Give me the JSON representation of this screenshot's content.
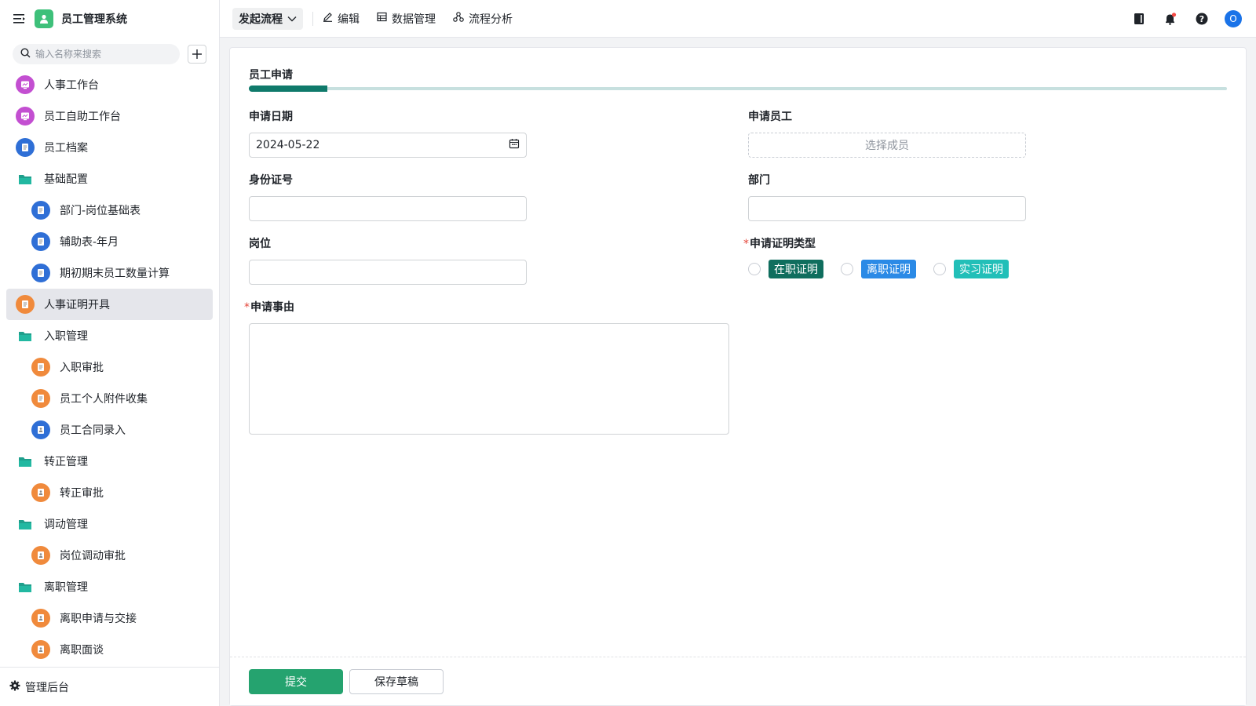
{
  "app": {
    "title": "员工管理系统"
  },
  "sidebar": {
    "search_placeholder": "输入名称来搜索",
    "items": [
      {
        "label": "人事工作台",
        "type": "app",
        "color": "#c34fd1",
        "icon": "dashboard-icon"
      },
      {
        "label": "员工自助工作台",
        "type": "app",
        "color": "#c34fd1",
        "icon": "dashboard-icon"
      },
      {
        "label": "员工档案",
        "type": "app",
        "color": "#2f6fd6",
        "icon": "document-icon"
      },
      {
        "label": "基础配置",
        "type": "folder"
      },
      {
        "label": "部门-岗位基础表",
        "type": "child",
        "color": "#2f6fd6",
        "icon": "document-icon"
      },
      {
        "label": "辅助表-年月",
        "type": "child",
        "color": "#2f6fd6",
        "icon": "document-icon"
      },
      {
        "label": "期初期末员工数量计算",
        "type": "child",
        "color": "#2f6fd6",
        "icon": "document-icon"
      },
      {
        "label": "人事证明开具",
        "type": "app",
        "color": "#f08a3c",
        "icon": "document-icon",
        "active": true
      },
      {
        "label": "入职管理",
        "type": "folder"
      },
      {
        "label": "入职审批",
        "type": "child",
        "color": "#f08a3c",
        "icon": "document-icon"
      },
      {
        "label": "员工个人附件收集",
        "type": "child",
        "color": "#f08a3c",
        "icon": "document-icon"
      },
      {
        "label": "员工合同录入",
        "type": "child",
        "color": "#2f6fd6",
        "icon": "flow-icon"
      },
      {
        "label": "转正管理",
        "type": "folder"
      },
      {
        "label": "转正审批",
        "type": "child",
        "color": "#f08a3c",
        "icon": "flow-icon"
      },
      {
        "label": "调动管理",
        "type": "folder"
      },
      {
        "label": "岗位调动审批",
        "type": "child",
        "color": "#f08a3c",
        "icon": "flow-icon"
      },
      {
        "label": "离职管理",
        "type": "folder"
      },
      {
        "label": "离职申请与交接",
        "type": "child",
        "color": "#f08a3c",
        "icon": "flow-icon"
      },
      {
        "label": "离职面谈",
        "type": "child",
        "color": "#f08a3c",
        "icon": "flow-icon"
      }
    ],
    "admin_label": "管理后台"
  },
  "topbar": {
    "start_flow": "发起流程",
    "edit": "编辑",
    "data_manage": "数据管理",
    "flow_analysis": "流程分析",
    "avatar": "O",
    "notification_dot_color": "#f54a45"
  },
  "form": {
    "title": "员工申请",
    "progress": 0.08,
    "accent_color": "#0f7a6b",
    "apply_date_label": "申请日期",
    "apply_date_value": "2024-05-22",
    "apply_employee_label": "申请员工",
    "apply_employee_placeholder": "选择成员",
    "id_number_label": "身份证号",
    "id_number_value": "",
    "department_label": "部门",
    "department_value": "",
    "position_label": "岗位",
    "position_value": "",
    "cert_type_label": "申请证明类型",
    "cert_types": [
      {
        "label": "在职证明",
        "color": "#0f6e5e"
      },
      {
        "label": "离职证明",
        "color": "#2b8ae6"
      },
      {
        "label": "实习证明",
        "color": "#22bfb8"
      }
    ],
    "reason_label": "申请事由",
    "reason_value": ""
  },
  "footer": {
    "submit": "提交",
    "save_draft": "保存草稿"
  }
}
